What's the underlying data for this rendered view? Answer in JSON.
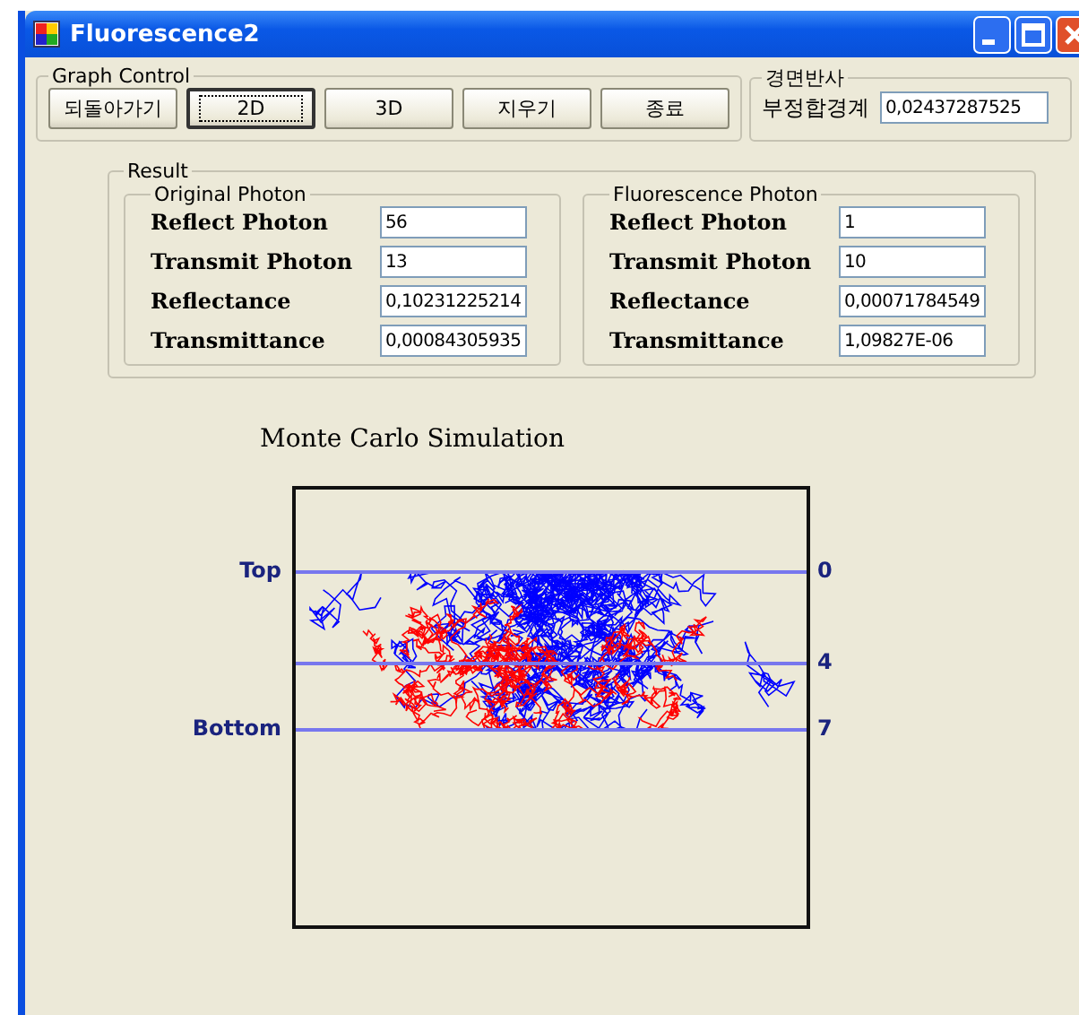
{
  "window": {
    "title": "Fluorescence2"
  },
  "graph_control": {
    "title": "Graph Control",
    "buttons": [
      {
        "label": "되돌아가기",
        "focused": false
      },
      {
        "label": "2D",
        "focused": true
      },
      {
        "label": "3D",
        "focused": false
      },
      {
        "label": "지우기",
        "focused": false
      },
      {
        "label": "종료",
        "focused": false
      }
    ]
  },
  "mirror": {
    "title": "경면반사",
    "label": "부정합경계",
    "value": "0,02437287525"
  },
  "result": {
    "title": "Result",
    "groups": [
      {
        "title": "Original Photon",
        "rows": [
          {
            "label": "Reflect Photon",
            "value": "56"
          },
          {
            "label": "Transmit Photon",
            "value": "13"
          },
          {
            "label": "Reflectance",
            "value": "0,10231225214"
          },
          {
            "label": "Transmittance",
            "value": "0,00084305935"
          }
        ]
      },
      {
        "title": "Fluorescence Photon",
        "rows": [
          {
            "label": "Reflect Photon",
            "value": "1"
          },
          {
            "label": "Transmit Photon",
            "value": "10"
          },
          {
            "label": "Reflectance",
            "value": "0,00071784549"
          },
          {
            "label": "Transmittance",
            "value": "1,09827E-06"
          }
        ]
      }
    ]
  },
  "plot": {
    "title": "Monte Carlo Simulation",
    "layers": [
      {
        "left_label": "Top",
        "right_label": "0"
      },
      {
        "right_label": "4"
      },
      {
        "left_label": "Bottom",
        "right_label": "7"
      }
    ]
  }
}
